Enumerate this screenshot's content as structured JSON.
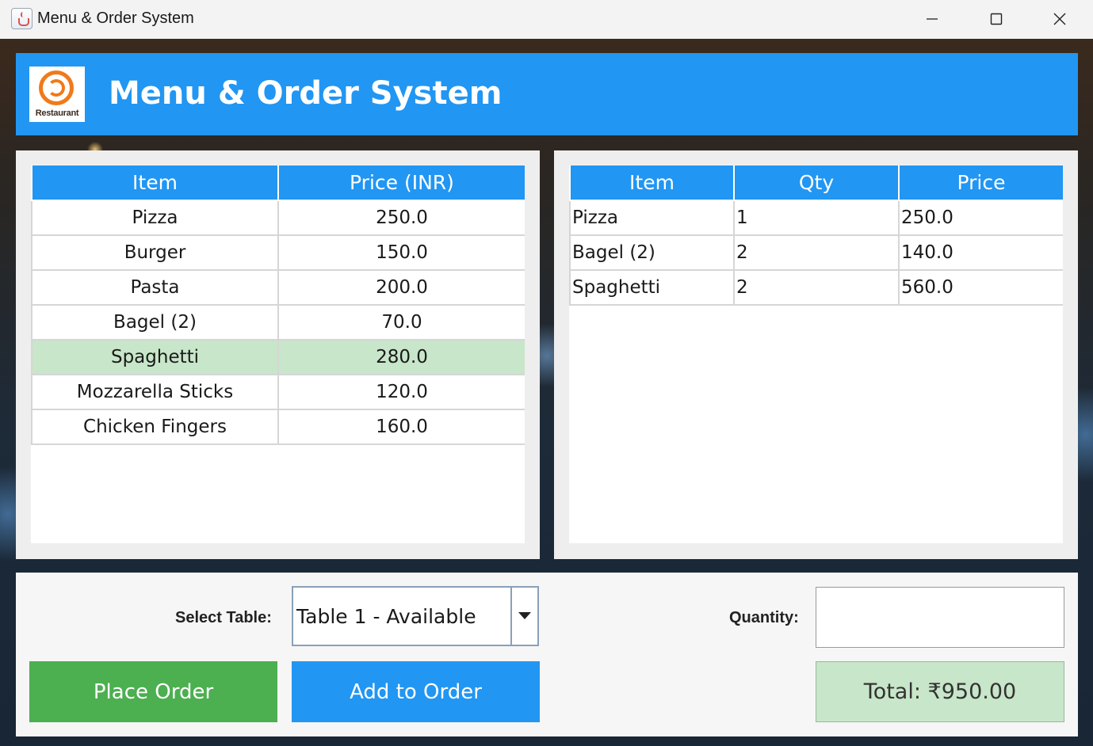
{
  "window": {
    "title": "Menu & Order System"
  },
  "header": {
    "title": "Menu & Order System",
    "logo_text": "Restaurant"
  },
  "menu_table": {
    "columns": [
      "Item",
      "Price (INR)"
    ],
    "rows": [
      {
        "item": "Pizza",
        "price": "250.0"
      },
      {
        "item": "Burger",
        "price": "150.0"
      },
      {
        "item": "Pasta",
        "price": "200.0"
      },
      {
        "item": "Bagel (2)",
        "price": "70.0"
      },
      {
        "item": "Spaghetti",
        "price": "280.0"
      },
      {
        "item": "Mozzarella Sticks",
        "price": "120.0"
      },
      {
        "item": "Chicken Fingers",
        "price": "160.0"
      }
    ],
    "selected_index": 4
  },
  "order_table": {
    "columns": [
      "Item",
      "Qty",
      "Price"
    ],
    "rows": [
      {
        "item": "Pizza",
        "qty": "1",
        "price": "250.0"
      },
      {
        "item": "Bagel (2)",
        "qty": "2",
        "price": "140.0"
      },
      {
        "item": "Spaghetti",
        "qty": "2",
        "price": "560.0"
      }
    ]
  },
  "controls": {
    "select_table_label": "Select Table:",
    "select_table_value": "Table 1 - Available",
    "quantity_label": "Quantity:",
    "quantity_value": "",
    "place_order_label": "Place Order",
    "add_to_order_label": "Add to Order",
    "total_label": "Total: ₹950.00"
  },
  "colors": {
    "header_blue": "#2196f3",
    "place_order_green": "#4caf50",
    "selected_row": "#c8e6c9",
    "total_bg": "#c8e6c9"
  },
  "icons": {
    "app": "java-coffee-cup-icon",
    "minimize": "minimize-icon",
    "maximize": "maximize-icon",
    "close": "close-icon",
    "dropdown": "chevron-down-icon",
    "logo": "restaurant-logo-icon"
  }
}
